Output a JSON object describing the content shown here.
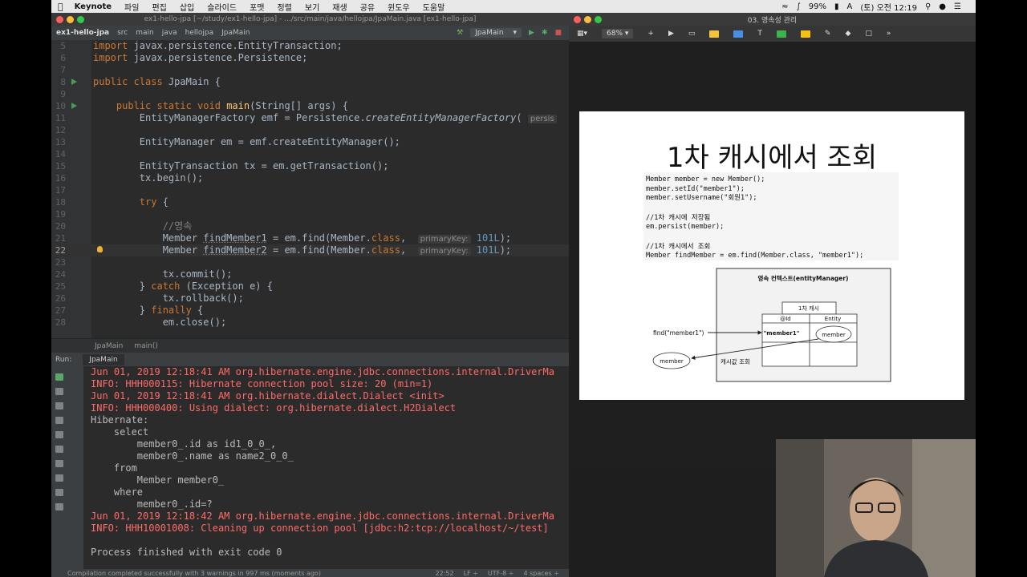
{
  "menubar": {
    "app": "Keynote",
    "items": [
      "파일",
      "편집",
      "삽입",
      "슬라이드",
      "포맷",
      "정렬",
      "보기",
      "재생",
      "공유",
      "윈도우",
      "도움말"
    ],
    "battery": "99%",
    "clock": "(토) 오전 12:19"
  },
  "ide": {
    "title": "ex1-hello-jpa [~/study/ex1-hello-jpa] - .../src/main/java/hellojpa/JpaMain.java [ex1-hello-jpa]",
    "breadcrumbs": [
      "ex1-hello-jpa",
      "src",
      "main",
      "java",
      "hellojpa",
      "JpaMain"
    ],
    "run_config": "JpaMain",
    "code": [
      {
        "n": "5",
        "pre": "import javax.persistence.EntityTransaction;"
      },
      {
        "n": "6",
        "pre": "import javax.persistence.Persistence;"
      },
      {
        "n": "7",
        "pre": ""
      },
      {
        "n": "8",
        "pre": "public class JpaMain {"
      },
      {
        "n": "9",
        "pre": ""
      },
      {
        "n": "10",
        "pre": "    public static void main(String[] args) {"
      },
      {
        "n": "11",
        "pre": "        EntityManagerFactory emf = Persistence.createEntityManagerFactory( persis"
      },
      {
        "n": "12",
        "pre": ""
      },
      {
        "n": "13",
        "pre": "        EntityManager em = emf.createEntityManager();"
      },
      {
        "n": "14",
        "pre": ""
      },
      {
        "n": "15",
        "pre": "        EntityTransaction tx = em.getTransaction();"
      },
      {
        "n": "16",
        "pre": "        tx.begin();"
      },
      {
        "n": "17",
        "pre": ""
      },
      {
        "n": "18",
        "pre": "        try {"
      },
      {
        "n": "19",
        "pre": ""
      },
      {
        "n": "20",
        "pre": "            //영속"
      },
      {
        "n": "21",
        "pre": "            Member findMember1 = em.find(Member.class,  primaryKey: 101L);"
      },
      {
        "n": "22",
        "pre": "            Member findMember2 = em.find(Member.class,  primaryKey: 101L);"
      },
      {
        "n": "23",
        "pre": ""
      },
      {
        "n": "24",
        "pre": "            tx.commit();"
      },
      {
        "n": "25",
        "pre": "        } catch (Exception e) {"
      },
      {
        "n": "26",
        "pre": "            tx.rollback();"
      },
      {
        "n": "27",
        "pre": "        } finally {"
      },
      {
        "n": "28",
        "pre": "            em.close();"
      }
    ],
    "editor_breadcrumb": [
      "JpaMain",
      "main()"
    ],
    "run_label": "Run:",
    "run_tab": "JpaMain",
    "console": [
      {
        "t": "Jun 01, 2019 12:18:41 AM org.hibernate.engine.jdbc.connections.internal.DriverMa",
        "red": true
      },
      {
        "t": "INFO: HHH000115: Hibernate connection pool size: 20 (min=1)",
        "red": true
      },
      {
        "t": "Jun 01, 2019 12:18:41 AM org.hibernate.dialect.Dialect <init>",
        "red": true
      },
      {
        "t": "INFO: HHH000400: Using dialect: org.hibernate.dialect.H2Dialect",
        "red": true
      },
      {
        "t": "Hibernate:",
        "red": false
      },
      {
        "t": "    select",
        "red": false
      },
      {
        "t": "        member0_.id as id1_0_0_,",
        "red": false
      },
      {
        "t": "        member0_.name as name2_0_0_",
        "red": false
      },
      {
        "t": "    from",
        "red": false
      },
      {
        "t": "        Member member0_",
        "red": false
      },
      {
        "t": "    where",
        "red": false
      },
      {
        "t": "        member0_.id=?",
        "red": false
      },
      {
        "t": "Jun 01, 2019 12:18:42 AM org.hibernate.engine.jdbc.connections.internal.DriverMa",
        "red": true
      },
      {
        "t": "INFO: HHH10001008: Cleaning up connection pool [jdbc:h2:tcp://localhost/~/test]",
        "red": true
      },
      {
        "t": "",
        "red": false
      },
      {
        "t": "Process finished with exit code 0",
        "red": false
      }
    ],
    "status_left": "Compilation completed successfully with 3 warnings in 997 ms (moments ago)",
    "status_right": [
      "22:52",
      "LF ÷",
      "UTF-8 ÷",
      "4 spaces ÷"
    ]
  },
  "keynote": {
    "title": "03. 영속성 관리",
    "zoom": "68% ▾",
    "slide": {
      "title": "1차 캐시에서 조회",
      "code1": [
        "Member member = new Member();",
        "member.setId(\"member1\");",
        "member.setUsername(\"회원1\");"
      ],
      "code2": [
        "//1차 캐시에 저장됨",
        "em.persist(member);"
      ],
      "code3": [
        "//1차 캐시에서 조회",
        "Member findMember = em.find(Member.class, \"member1\");"
      ],
      "diagram": {
        "context_label": "영속 컨텍스트(entityManager)",
        "cache_label": "1차 캐시",
        "col_id": "@Id",
        "col_entity": "Entity",
        "cell_id": "\"member1\"",
        "cell_entity": "member",
        "find_label": "find(\"member1\")",
        "result_label": "member",
        "lookup_label": "캐시값 조회"
      }
    }
  },
  "colors": {
    "keyword": "#cc7832",
    "method": "#ffc66d",
    "console_red": "#ff6b68",
    "ide_bg": "#2b2b2b"
  }
}
